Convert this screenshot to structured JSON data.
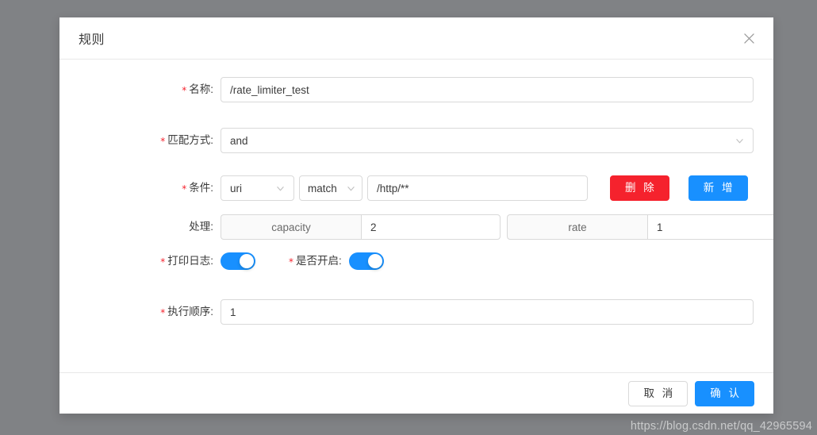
{
  "dialog": {
    "title": "规则",
    "close_icon": "close-icon"
  },
  "form": {
    "name": {
      "label": "名称:",
      "required": true,
      "value": "/rate_limiter_test"
    },
    "match_mode": {
      "label": "匹配方式:",
      "required": true,
      "value": "and"
    },
    "condition": {
      "label": "条件:",
      "required": true,
      "field": "uri",
      "operator": "match",
      "value": "/http/**",
      "delete_label": "删 除",
      "add_label": "新 增"
    },
    "process": {
      "label": "处理:",
      "required": false,
      "items": [
        {
          "addon": "capacity",
          "value": "2"
        },
        {
          "addon": "rate",
          "value": "1"
        }
      ]
    },
    "print_log": {
      "label": "打印日志:",
      "required": true,
      "enabled": true
    },
    "is_enabled": {
      "label": "是否开启:",
      "required": true,
      "enabled": true
    },
    "order": {
      "label": "执行顺序:",
      "required": true,
      "value": "1"
    }
  },
  "footer": {
    "cancel_label": "取 消",
    "confirm_label": "确 认"
  },
  "watermark": "https://blog.csdn.net/qq_42965594",
  "colors": {
    "primary": "#1890ff",
    "danger": "#f5222d",
    "required_star": "#f5222d",
    "border": "#d9d9d9",
    "overlay": "#808285"
  }
}
